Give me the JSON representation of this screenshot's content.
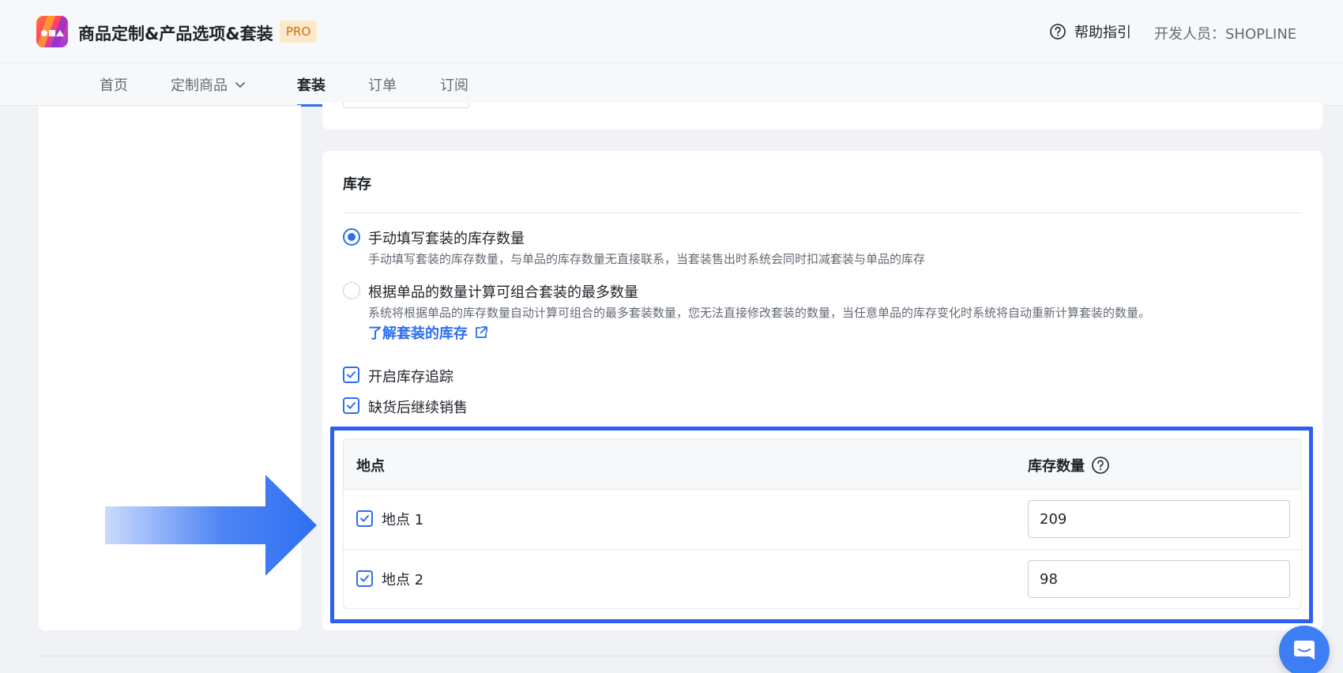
{
  "header": {
    "app_title": "商品定制&产品选项&套装",
    "badge": "PRO",
    "help_label": "帮助指引",
    "developer": "开发人员：SHOPLINE"
  },
  "nav": {
    "items": [
      {
        "label": "首页"
      },
      {
        "label": "定制商品"
      },
      {
        "label": "套装"
      },
      {
        "label": "订单"
      },
      {
        "label": "订阅"
      }
    ],
    "active": "套装"
  },
  "inventory": {
    "title": "库存",
    "options": [
      {
        "label": "手动填写套装的库存数量",
        "description": "手动填写套装的库存数量，与单品的库存数量无直接联系，当套装售出时系统会同时扣减套装与单品的库存",
        "selected": true
      },
      {
        "label": "根据单品的数量计算可组合套装的最多数量",
        "description": "系统将根据单品的库存数量自动计算可组合的最多套装数量，您无法直接修改套装的数量，当任意单品的库存变化时系统将自动重新计算套装的数量。",
        "selected": false
      }
    ],
    "learn_link": "了解套装的库存",
    "checkboxes": [
      {
        "label": "开启库存追踪",
        "checked": true
      },
      {
        "label": "缺货后继续销售",
        "checked": true
      }
    ],
    "table": {
      "col_location": "地点",
      "col_quantity": "库存数量",
      "rows": [
        {
          "location": "地点 1",
          "quantity": "209",
          "checked": true
        },
        {
          "location": "地点 2",
          "quantity": "98",
          "checked": true
        }
      ]
    }
  },
  "colors": {
    "accent": "#2d6ef0",
    "highlight": "#2f5ff0"
  },
  "icons": [
    "app-logo-icon",
    "help-circle-icon",
    "chevron-down-icon",
    "external-link-icon",
    "check-icon",
    "question-icon",
    "arrow-right-icon",
    "chat-icon"
  ]
}
